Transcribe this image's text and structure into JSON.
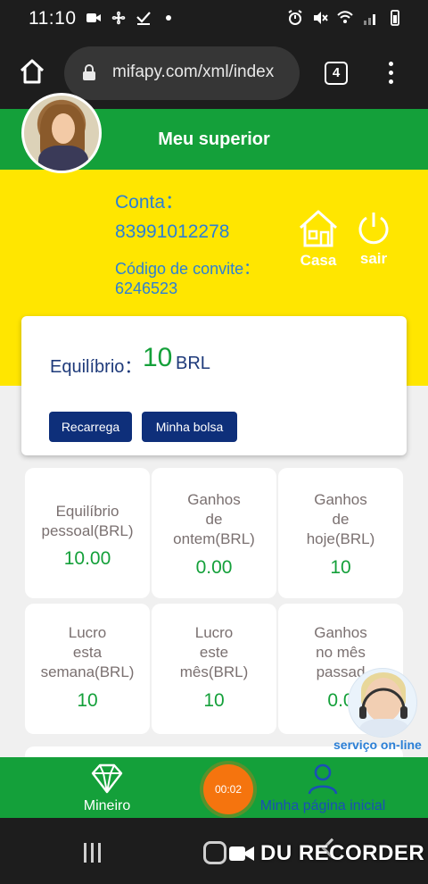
{
  "status_bar": {
    "time": "11:10",
    "left_icons": [
      "video-camera-icon",
      "fan-icon",
      "check-icon",
      "dot-icon"
    ],
    "right_icons": [
      "alarm-icon",
      "mute-icon",
      "wifi-icon",
      "signal-icon",
      "battery-icon"
    ]
  },
  "browser": {
    "url": "mifapy.com/xml/index",
    "tab_count": "4"
  },
  "header": {
    "title": "Meu superior"
  },
  "account": {
    "conta_label": "Conta：",
    "conta_value": "83991012278",
    "invite_label": "Código de convite：",
    "invite_value": "6246523",
    "casa_label": "Casa",
    "sair_label": "sair"
  },
  "balance": {
    "label": "Equilíbrio：",
    "value": "10",
    "unit": "BRL",
    "recharge_button": "Recarrega",
    "wallet_button": "Minha bolsa"
  },
  "stats": [
    {
      "lines": [
        "Equilíbrio",
        "pessoal(BRL)"
      ],
      "value": "10.00"
    },
    {
      "lines": [
        "Ganhos",
        "de",
        "ontem(BRL)"
      ],
      "value": "0.00"
    },
    {
      "lines": [
        "Ganhos",
        "de",
        "hoje(BRL)"
      ],
      "value": "10"
    },
    {
      "lines": [
        "Lucro",
        "esta",
        "semana(BRL)"
      ],
      "value": "10"
    },
    {
      "lines": [
        "Lucro",
        "este",
        "mês(BRL)"
      ],
      "value": "10"
    },
    {
      "lines": [
        "Ganhos",
        "no mês",
        "passad"
      ],
      "value": "0.0"
    }
  ],
  "support": {
    "label": "serviço on-line"
  },
  "bottom_nav": {
    "mineiro": "Mineiro",
    "inicial": "Minha página inicial",
    "recording_timer": "00:02"
  },
  "watermark": "DU RECORDER",
  "colors": {
    "green": "#14a03a",
    "yellow": "#ffe600",
    "navy": "#0e2f7a",
    "link_blue": "#2b7fd6",
    "record_orange": "#f5740e"
  }
}
